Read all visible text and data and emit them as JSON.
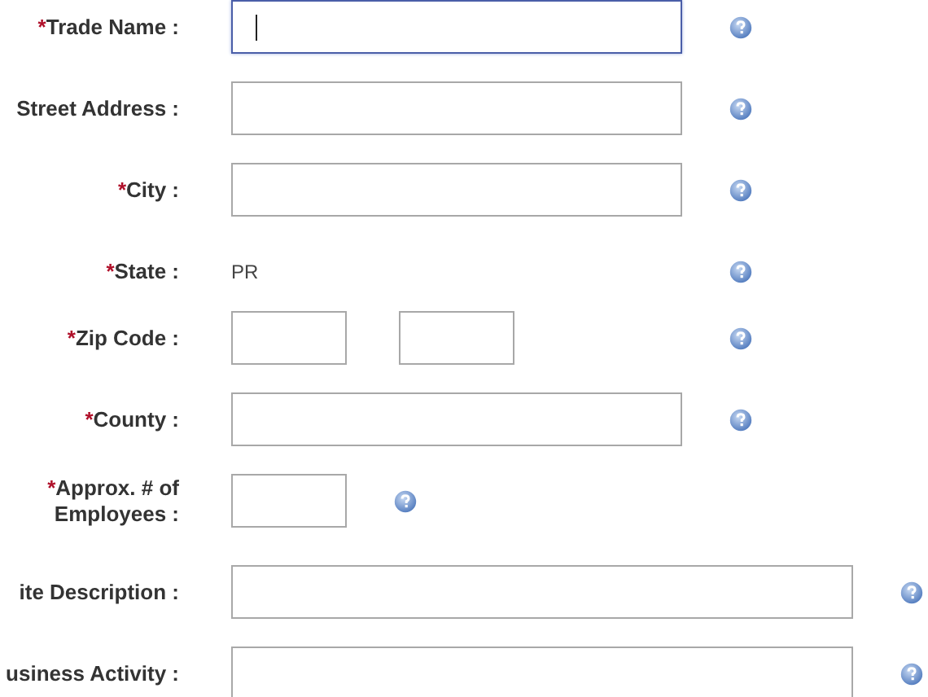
{
  "fields": [
    {
      "kind": "text",
      "mark": "*",
      "label": "Trade Name :",
      "focused": true
    },
    {
      "kind": "text",
      "label": "Street Address :",
      "focused": false
    },
    {
      "kind": "text",
      "mark": "*",
      "label": "City :",
      "focused": false
    },
    {
      "kind": "static",
      "mark": "*",
      "label": "State :",
      "value": "PR"
    },
    {
      "kind": "zip",
      "mark": "*",
      "label": "Zip Code :",
      "focused": false
    },
    {
      "kind": "text",
      "mark": "*",
      "label": "County :",
      "focused": false
    },
    {
      "kind": "number",
      "mark": "*",
      "label": "Approx. # of Employees :",
      "focused": false
    },
    {
      "kind": "long",
      "label": "ite Description :",
      "focused": false
    },
    {
      "kind": "long",
      "label": "usiness Activity :",
      "focused": false
    }
  ]
}
